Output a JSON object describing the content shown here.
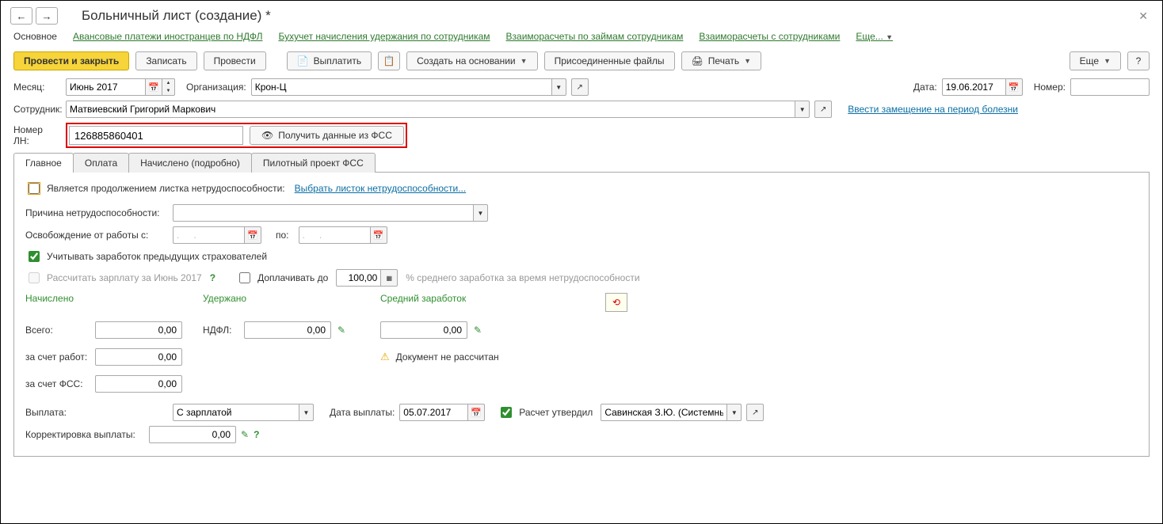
{
  "header": {
    "title": "Больничный лист (создание) *"
  },
  "navlinks": {
    "main": "Основное",
    "l1": "Авансовые платежи иностранцев по НДФЛ",
    "l2": "Бухучет начисления удержания по сотрудникам",
    "l3": "Взаиморасчеты по займам сотрудникам",
    "l4": "Взаиморасчеты с сотрудниками",
    "more": "Еще..."
  },
  "toolbar": {
    "post_close": "Провести и закрыть",
    "write": "Записать",
    "post": "Провести",
    "pay": "Выплатить",
    "create_on": "Создать на основании",
    "attached": "Присоединенные файлы",
    "print": "Печать",
    "more": "Еще",
    "help": "?"
  },
  "fields": {
    "month_lbl": "Месяц:",
    "month_val": "Июнь 2017",
    "org_lbl": "Организация:",
    "org_val": "Крон-Ц",
    "date_lbl": "Дата:",
    "date_val": "19.06.2017",
    "num_lbl": "Номер:",
    "num_val": "",
    "emp_lbl": "Сотрудник:",
    "emp_val": "Матвиевский Григорий Маркович",
    "sub_link": "Ввести замещение на период болезни",
    "ln_lbl": "Номер ЛН:",
    "ln_val": "126885860401",
    "fss_btn": "Получить данные из ФСС"
  },
  "tabs": {
    "t1": "Главное",
    "t2": "Оплата",
    "t3": "Начислено (подробно)",
    "t4": "Пилотный проект ФСС"
  },
  "main": {
    "cont_lbl": "Является продолжением листка нетрудоспособности:",
    "cont_link": "Выбрать листок нетрудоспособности...",
    "reason_lbl": "Причина нетрудоспособности:",
    "free_lbl": "Освобождение от работы с:",
    "po_lbl": "по:",
    "date_placeholder": ".   .",
    "prev_ins": "Учитывать заработок предыдущих страхователей",
    "calc_salary": "Рассчитать зарплату за Июнь 2017",
    "topup_lbl": "Доплачивать до",
    "topup_val": "100,00",
    "topup_tail": "% среднего заработка за время нетрудоспособности",
    "calc": {
      "nach": "Начислено",
      "ud": "Удержано",
      "avg": "Средний заработок",
      "vsego": "Всего:",
      "ndfl": "НДФЛ:",
      "rabot": "за счет работ:",
      "fss": "за счет ФСС:",
      "zero": "0,00",
      "not_calc": "Документ не рассчитан"
    },
    "pay_lbl": "Выплата:",
    "pay_sel": "С зарплатой",
    "pay_date_lbl": "Дата выплаты:",
    "pay_date": "05.07.2017",
    "approve_lbl": "Расчет утвердил",
    "approve_val": "Савинская З.Ю. (Системнь",
    "corr_lbl": "Корректировка выплаты:",
    "corr_val": "0,00"
  }
}
